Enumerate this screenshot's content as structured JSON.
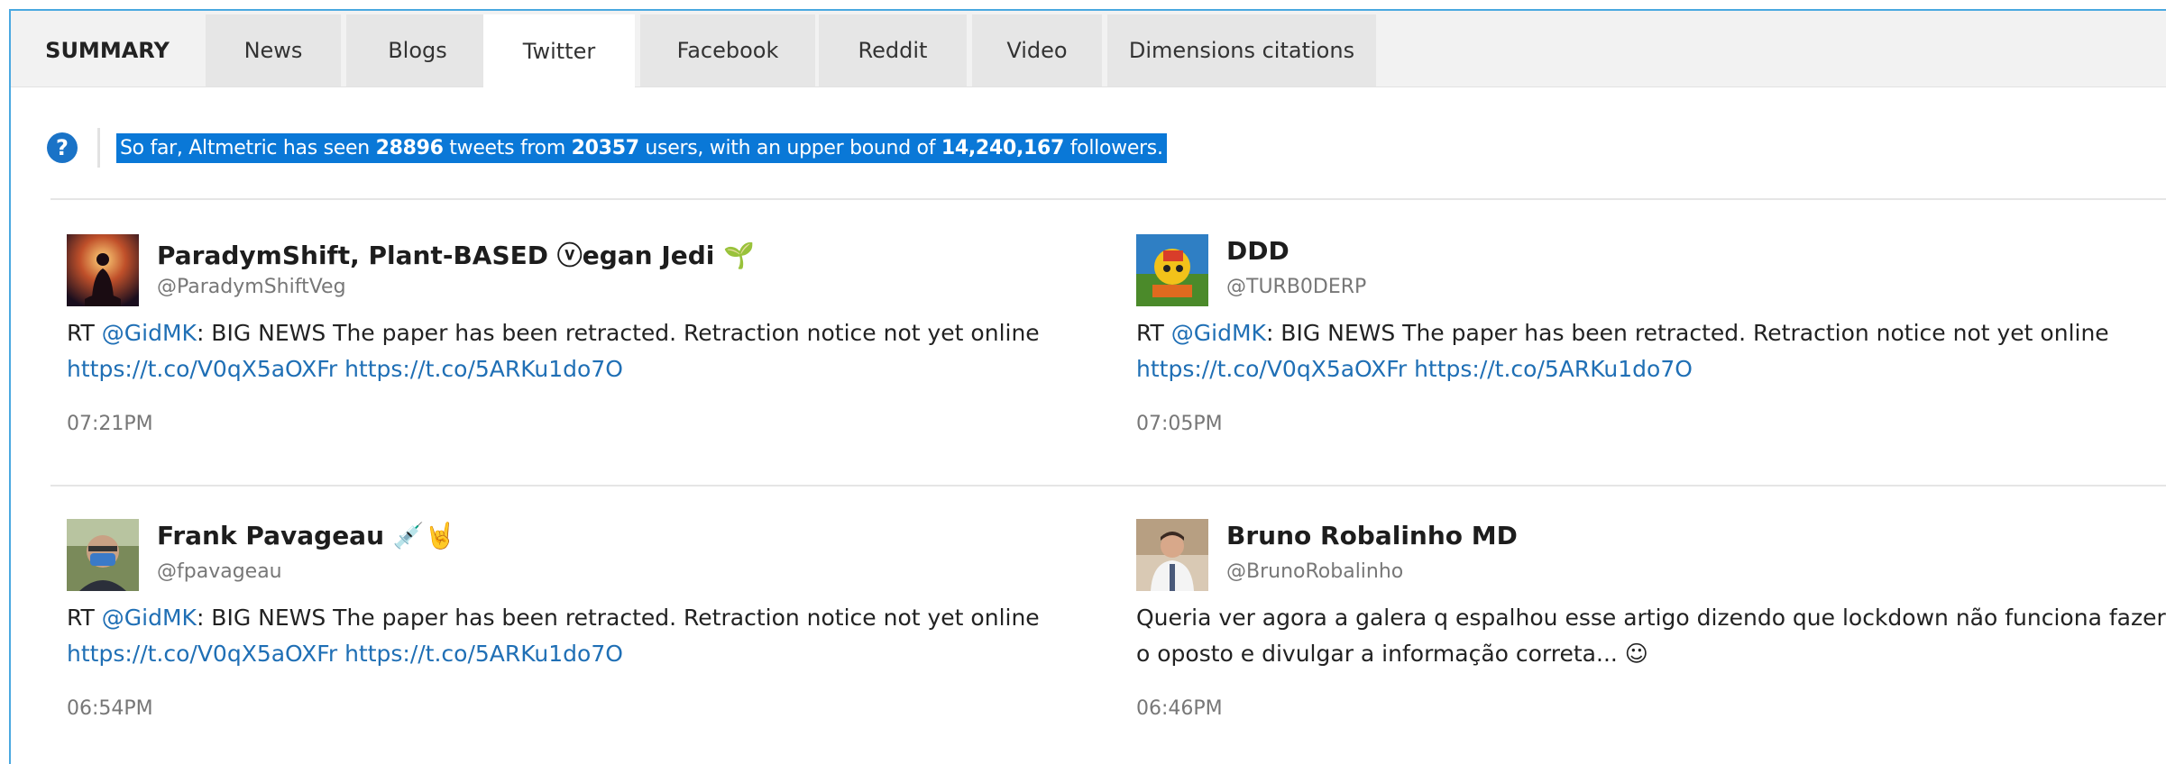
{
  "tabs": [
    {
      "label": "SUMMARY"
    },
    {
      "label": "News"
    },
    {
      "label": "Blogs"
    },
    {
      "label": "Twitter"
    },
    {
      "label": "Facebook"
    },
    {
      "label": "Reddit"
    },
    {
      "label": "Video"
    },
    {
      "label": "Dimensions citations"
    }
  ],
  "active_tab": "Twitter",
  "info": {
    "help_icon": "question-circle-icon",
    "pre": "So far, Altmetric has seen ",
    "tweets": "28896",
    "mid1": " tweets from ",
    "users": "20357",
    "mid2": " users, with an upper bound of ",
    "followers": "14,240,167",
    "post": " followers."
  },
  "tweets": [
    {
      "name": "ParadymShift, Plant-BASED ⓥegan Jedi",
      "name_emoji": "🌱",
      "handle": "@ParadymShiftVeg",
      "text_pre": "RT ",
      "mention": "@GidMK",
      "text_main": ": BIG NEWS The paper has been retracted. Retraction notice not yet online",
      "link1": "https://t.co/V0qX5aOXFr",
      "link2": "https://t.co/5ARKu1do7O",
      "time": "07:21PM"
    },
    {
      "name": "DDD",
      "name_emoji": "",
      "handle": "@TURB0DERP",
      "text_pre": "RT ",
      "mention": "@GidMK",
      "text_main": ": BIG NEWS The paper has been retracted. Retraction notice not yet online",
      "link1": "https://t.co/V0qX5aOXFr",
      "link2": "https://t.co/5ARKu1do7O",
      "time": "07:05PM"
    },
    {
      "name": "Frank Pavageau",
      "name_emoji": "💉🤘",
      "handle": "@fpavageau",
      "text_pre": "RT ",
      "mention": "@GidMK",
      "text_main": ": BIG NEWS The paper has been retracted. Retraction notice not yet online",
      "link1": "https://t.co/V0qX5aOXFr",
      "link2": "https://t.co/5ARKu1do7O",
      "time": "06:54PM"
    },
    {
      "name": "Bruno Robalinho MD",
      "name_emoji": "",
      "handle": "@BrunoRobalinho",
      "text": "Queria ver agora a galera q espalhou esse artigo dizendo que lockdown não funciona fazer o oposto e divulgar a informação correta... ☺",
      "time": "06:46PM"
    }
  ],
  "colors": {
    "accent": "#0a78d7",
    "link": "#1f6fb5",
    "frame_border": "#4aa8e0"
  }
}
